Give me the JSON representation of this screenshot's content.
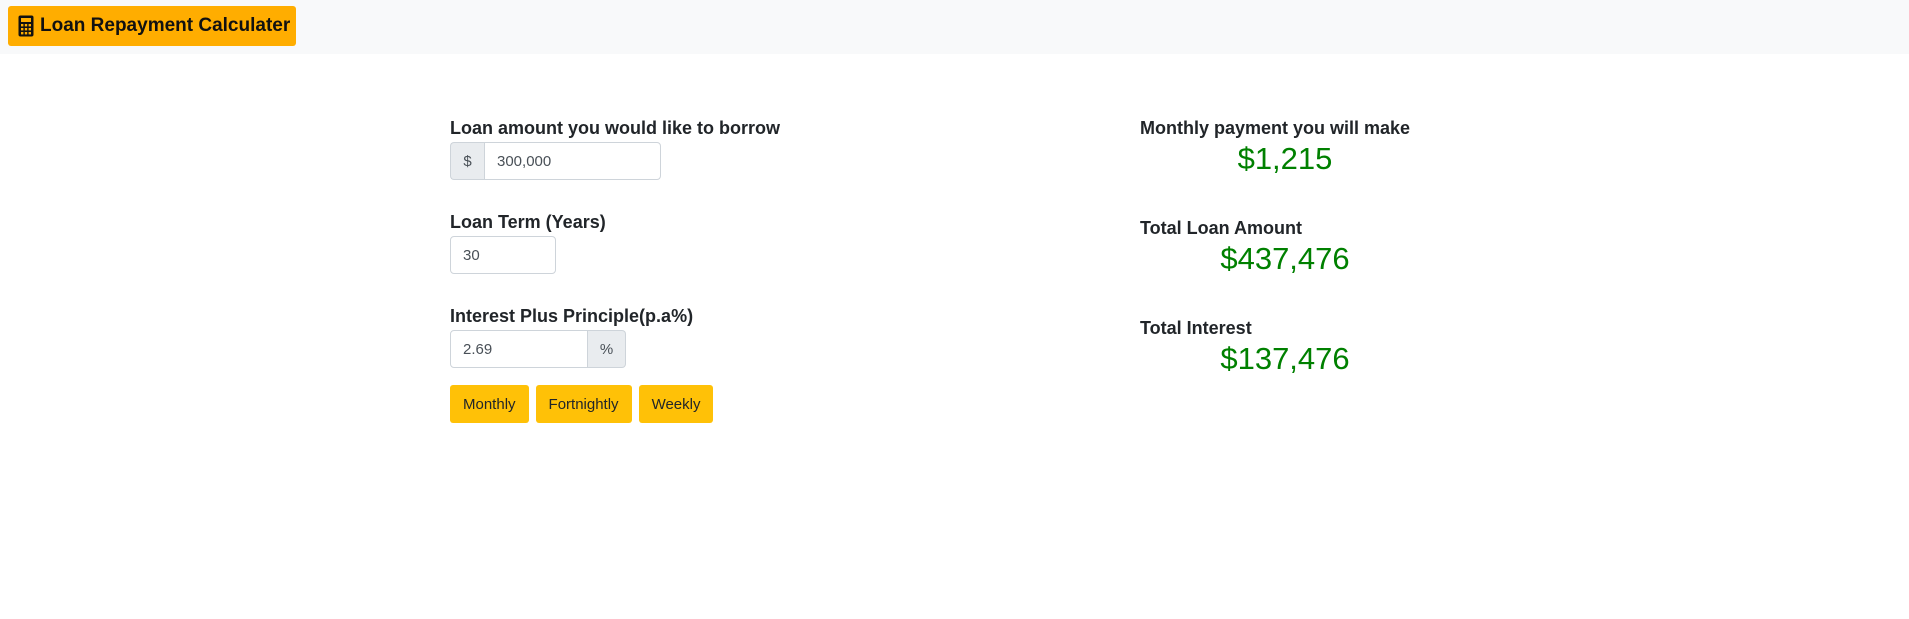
{
  "header": {
    "brand_icon": "calculator-icon",
    "brand_title": "Loan Repayment Calculater",
    "brand_color": "#ffad00"
  },
  "form": {
    "loan_amount": {
      "label": "Loan amount you would like to borrow",
      "prefix": "$",
      "value": "300,000"
    },
    "loan_term": {
      "label": "Loan Term (Years)",
      "value": "30"
    },
    "interest": {
      "label": "Interest Plus Principle(p.a%)",
      "value": "2.69",
      "suffix": "%"
    },
    "buttons": {
      "monthly": "Monthly",
      "fortnightly": "Fortnightly",
      "weekly": "Weekly"
    },
    "button_color": "#ffc107"
  },
  "results": {
    "payment": {
      "label": "Monthly payment you will make",
      "value": "$1,215"
    },
    "total_loan": {
      "label": "Total Loan Amount",
      "value": "$437,476"
    },
    "total_interest": {
      "label": "Total Interest",
      "value": "$137,476"
    },
    "value_color": "#008000"
  }
}
